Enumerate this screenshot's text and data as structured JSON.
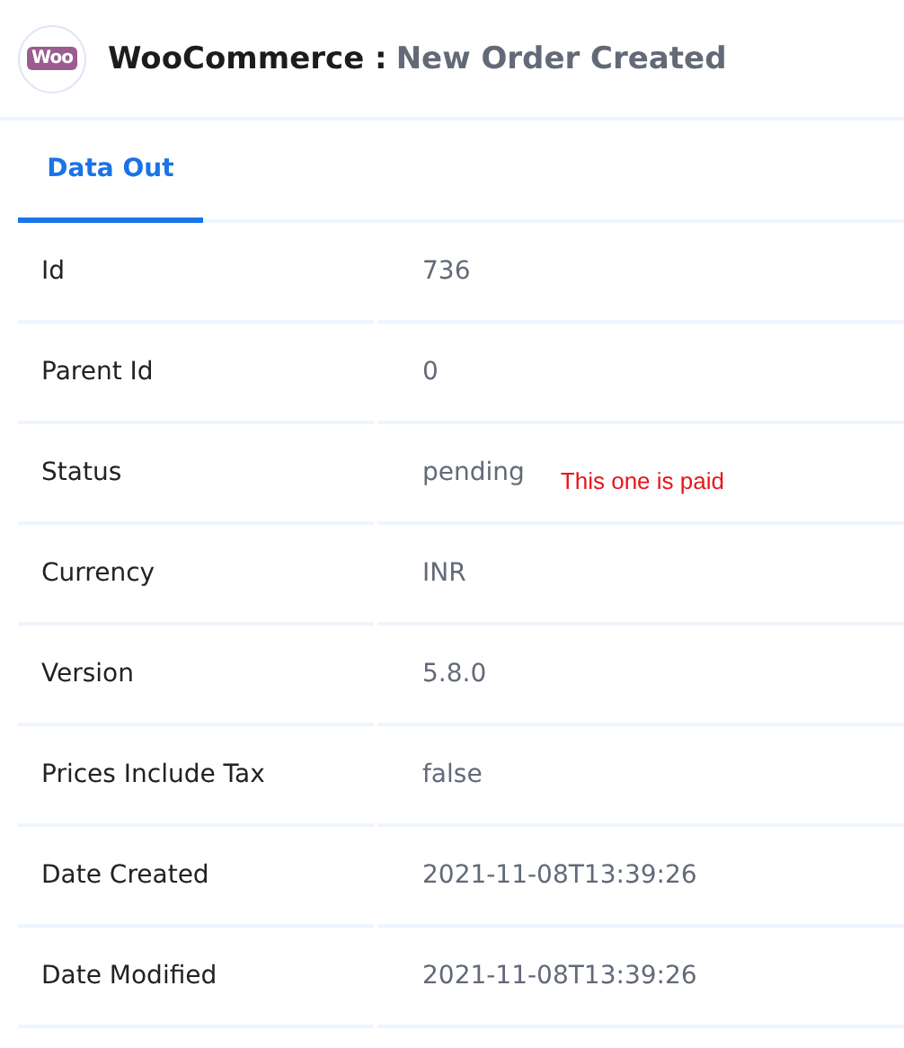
{
  "header": {
    "logo_text": "Woo",
    "app": "WooCommerce :",
    "event": "New Order Created"
  },
  "tabs": [
    {
      "label": "Data Out",
      "selected": true
    }
  ],
  "rows": [
    {
      "label": "Id",
      "value": "736"
    },
    {
      "label": "Parent Id",
      "value": "0"
    },
    {
      "label": "Status",
      "value": "pending",
      "note": "This one is paid"
    },
    {
      "label": "Currency",
      "value": "INR"
    },
    {
      "label": "Version",
      "value": "5.8.0"
    },
    {
      "label": "Prices Include Tax",
      "value": "false"
    },
    {
      "label": "Date Created",
      "value": "2021-11-08T13:39:26"
    },
    {
      "label": "Date Modified",
      "value": "2021-11-08T13:39:26"
    }
  ]
}
